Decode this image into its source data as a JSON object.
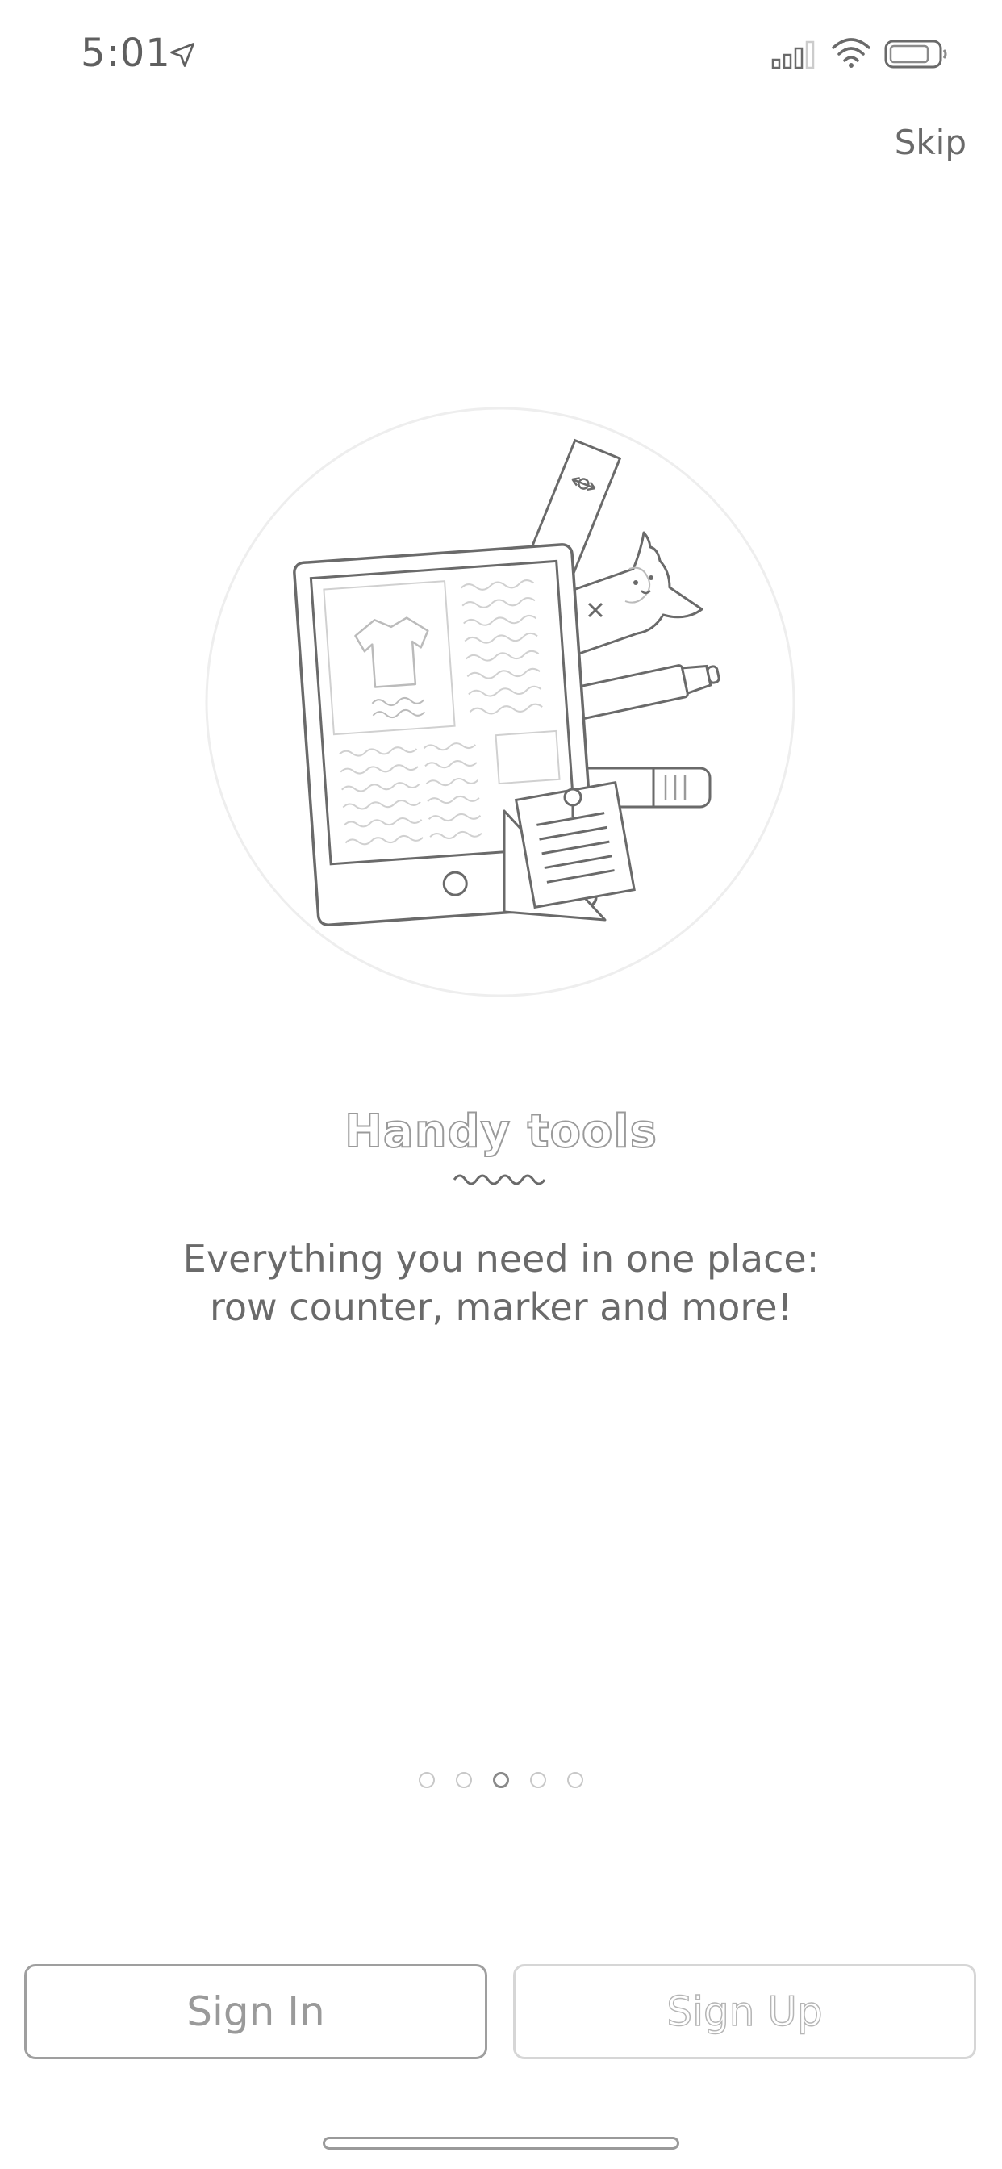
{
  "status_bar": {
    "time": "5:01",
    "icons": [
      "location-arrow-icon",
      "cellular-signal-icon",
      "wifi-icon",
      "battery-icon"
    ]
  },
  "header": {
    "skip_label": "Skip"
  },
  "onboarding": {
    "illustration": "tablet-with-ruler-alpaca-marker-notes",
    "title": "Handy tools",
    "description_line1": "Everything you need in one place:",
    "description_line2": "row counter, marker and more!",
    "pages_total": 5,
    "active_page": 3
  },
  "actions": {
    "sign_in_label": "Sign In",
    "sign_up_label": "Sign Up"
  },
  "colors": {
    "line": "#6a6a6a",
    "light_line": "#c8c8c8",
    "background": "#ffffff"
  }
}
